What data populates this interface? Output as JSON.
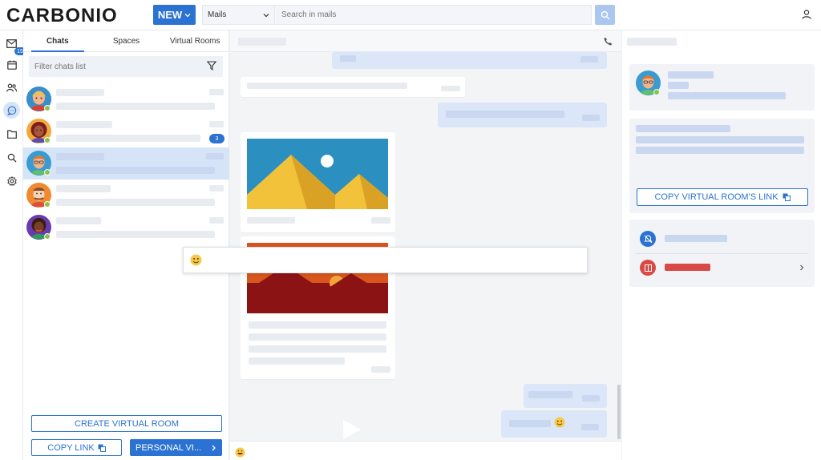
{
  "app": {
    "logo": "CARBONIO"
  },
  "header": {
    "new_label": "NEW",
    "search_scope": "Mails",
    "search_placeholder": "Search in mails"
  },
  "rail": {
    "mail_badge": "15"
  },
  "tabs": [
    "Chats",
    "Spaces",
    "Virtual Rooms"
  ],
  "filter_placeholder": "Filter chats list",
  "chats": [
    {
      "unread": ""
    },
    {
      "unread": "3"
    },
    {
      "unread": ""
    },
    {
      "unread": ""
    },
    {
      "unread": ""
    }
  ],
  "list_actions": {
    "create": "CREATE VIRTUAL ROOM",
    "copy": "COPY LINK",
    "personal": "PERSONAL VI..."
  },
  "info": {
    "copy_link": "COPY VIRTUAL ROOM'S LINK"
  },
  "colors": {
    "accent": "#2b73d2",
    "danger": "#d94a46",
    "online": "#8bc34a"
  }
}
